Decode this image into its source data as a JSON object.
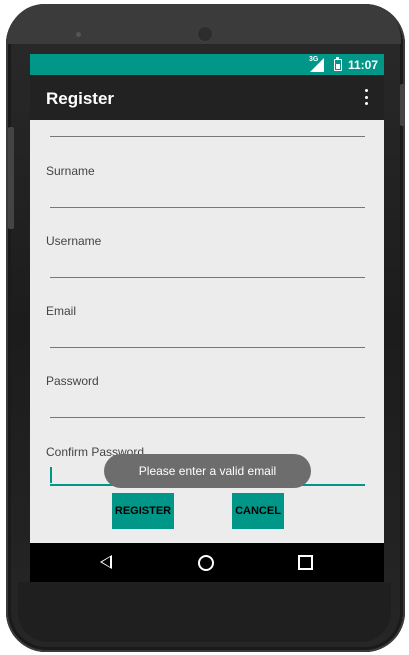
{
  "status_bar": {
    "network": "3G",
    "time": "11:07"
  },
  "app_bar": {
    "title": "Register",
    "overflow_icon": "more-vert-icon"
  },
  "form": {
    "fields": [
      {
        "label": "",
        "value": ""
      },
      {
        "label": "Surname",
        "value": ""
      },
      {
        "label": "Username",
        "value": ""
      },
      {
        "label": "Email",
        "value": ""
      },
      {
        "label": "Password",
        "value": ""
      },
      {
        "label": "Confirm Password",
        "value": ""
      }
    ]
  },
  "buttons": {
    "register": "REGISTER",
    "cancel": "CANCEL"
  },
  "toast": {
    "message": "Please enter a valid email"
  },
  "colors": {
    "accent": "#009688",
    "app_bar": "#222222",
    "background": "#ececec"
  },
  "nav": {
    "back_icon": "back-triangle-icon",
    "home_icon": "home-circle-icon",
    "recents_icon": "recents-square-icon"
  }
}
